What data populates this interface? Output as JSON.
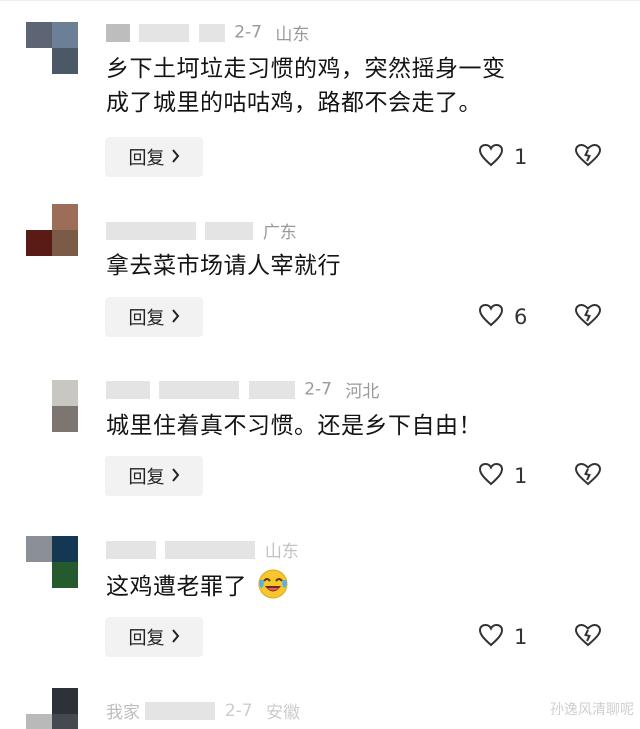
{
  "comments": [
    {
      "date": "2-7",
      "location": "山东",
      "text_line1": "乡下土坷垃走习惯的鸡，突然摇身一变",
      "text_line2": "成了城里的咕咕鸡，路都不会走了。",
      "reply_label": "回复",
      "likes": "1"
    },
    {
      "date": "",
      "location": "广东",
      "text_line1": "拿去菜市场请人宰就行",
      "reply_label": "回复",
      "likes": "6"
    },
    {
      "date": "2-7",
      "location": "河北",
      "text_line1": "城里住着真不习惯。还是乡下自由！",
      "reply_label": "回复",
      "likes": "1"
    },
    {
      "date": "",
      "location": "山东",
      "text_line1": "这鸡遭老罪了",
      "reply_label": "回复",
      "likes": "1"
    },
    {
      "date": "2-7",
      "location": "安徽",
      "name_fragment": "我家"
    }
  ],
  "watermark": "孙逸风清聊呢",
  "icons": {
    "like": "heart-outline-icon",
    "dislike": "broken-heart-icon",
    "reply_chevron": "chevron-right-icon",
    "emoji": "crying-laughing-emoji"
  },
  "colors": {
    "meta_text": "#9a9a9a",
    "body_text": "#141414",
    "reply_bg": "#f2f2f2"
  }
}
